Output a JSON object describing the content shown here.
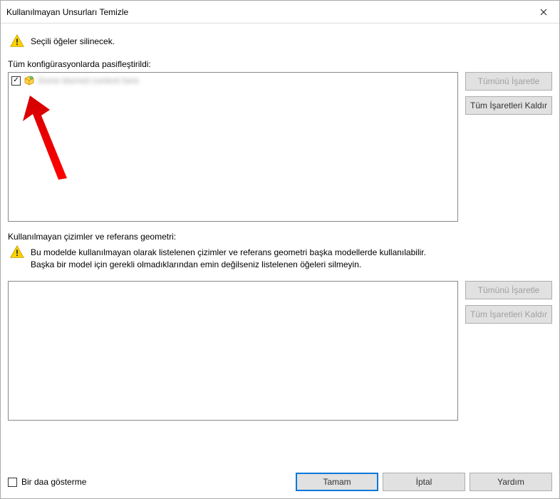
{
  "titlebar": {
    "title": "Kullanılmayan Unsurları Temizle"
  },
  "warning_top": "Seçili öğeler silinecek.",
  "section1_label": "Tüm konfigürasyonlarda pasifleştirildi:",
  "list1": {
    "item_label": "Some blurred content here"
  },
  "side1": {
    "select_all": "Tümünü İşaretle",
    "deselect_all": "Tüm İşaretleri Kaldır"
  },
  "section2_label": "Kullanılmayan çizimler ve referans geometri:",
  "warning_ref": {
    "line1": "Bu modelde kullanılmayan olarak listelenen çizimler ve referans geometri başka modellerde kullanılabilir.",
    "line2": "Başka bir model için gerekli olmadıklarından emin değilseniz listelenen öğeleri silmeyin."
  },
  "side2": {
    "select_all": "Tümünü İşaretle",
    "deselect_all": "Tüm İşaretleri Kaldır"
  },
  "footer": {
    "dont_show_again": "Bir daa gösterme",
    "ok": "Tamam",
    "cancel": "İptal",
    "help": "Yardım"
  }
}
